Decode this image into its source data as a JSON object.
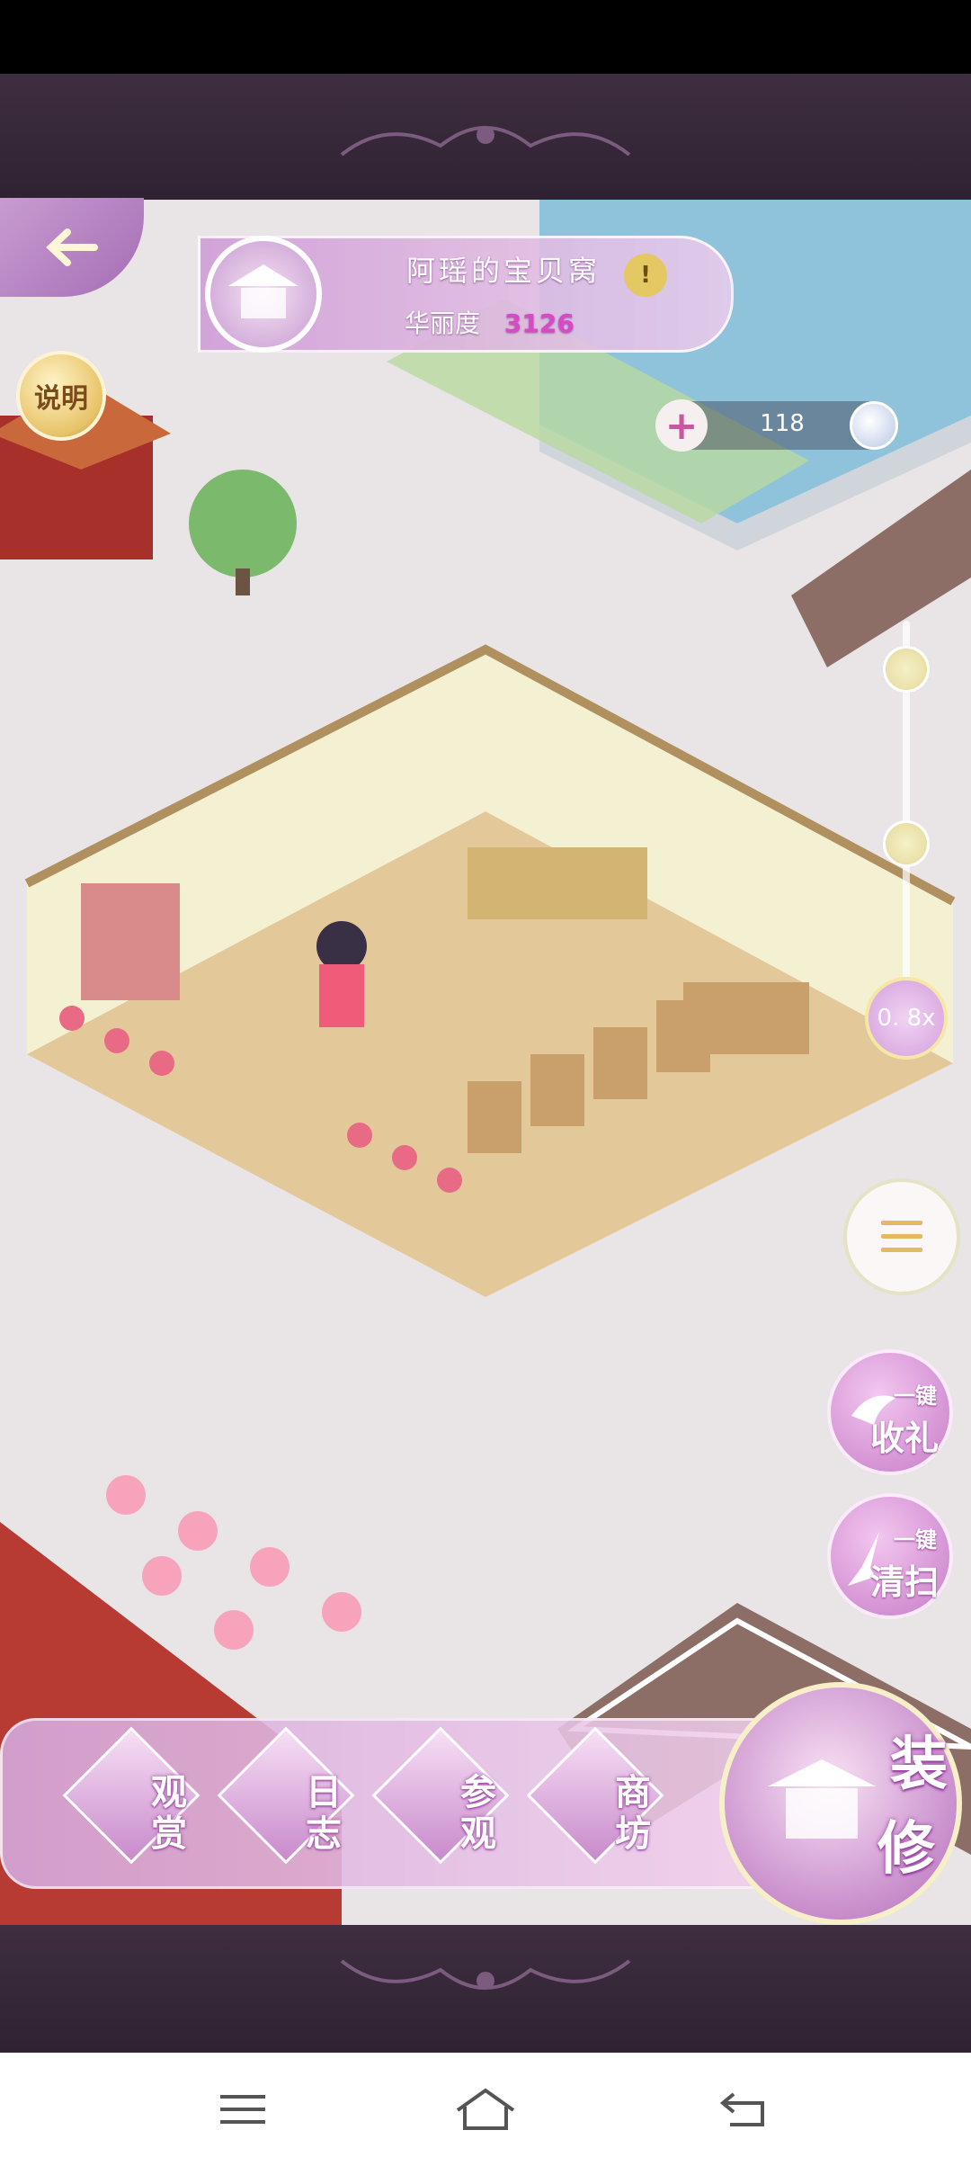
{
  "hud": {
    "title": "阿瑶的宝贝窝",
    "score_label": "华丽度",
    "score_value": "3126",
    "info_badge": "!",
    "currency_plus": "+",
    "currency_amount": "118",
    "help_label": "说明",
    "zoom_label": "0. 8x"
  },
  "actions": {
    "collect_small": "一键",
    "collect_big": "收礼",
    "clean_small": "一键",
    "clean_big": "清扫"
  },
  "bottom_bar": {
    "items": [
      {
        "l1": "观",
        "l2": "赏"
      },
      {
        "l1": "日",
        "l2": "志"
      },
      {
        "l1": "参",
        "l2": "观"
      },
      {
        "l1": "商",
        "l2": "坊"
      }
    ],
    "decorate_1": "装",
    "decorate_2": "修"
  },
  "colors": {
    "accent": "#c77dc8",
    "score_highlight": "#d64ac6"
  }
}
